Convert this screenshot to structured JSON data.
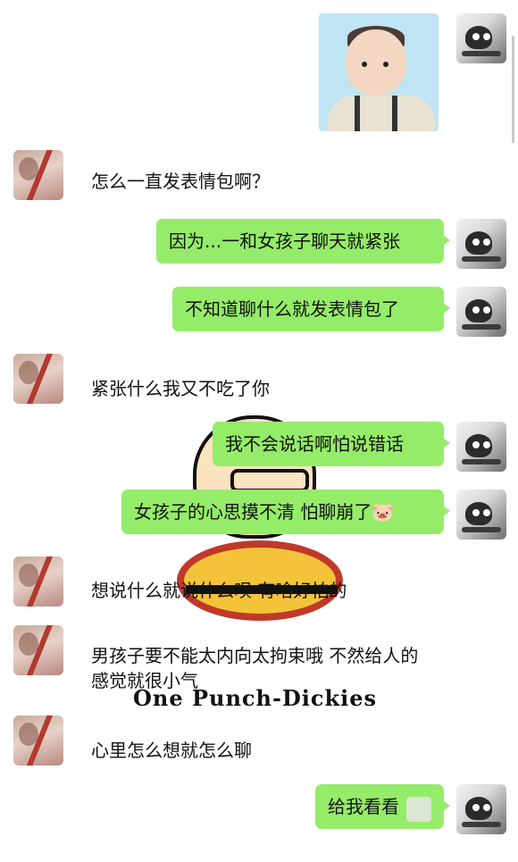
{
  "chat": {
    "messages": [
      {
        "side": "right",
        "type": "sticker",
        "sticker_icon": "baby-sticker"
      },
      {
        "side": "left",
        "type": "text",
        "text": "怎么一直发表情包啊？"
      },
      {
        "side": "right",
        "type": "text",
        "text": "因为...一和女孩子聊天就紧张"
      },
      {
        "side": "right",
        "type": "text",
        "text": "不知道聊什么就发表情包了"
      },
      {
        "side": "left",
        "type": "text",
        "text": "紧张什么我又不吃了你"
      },
      {
        "side": "right",
        "type": "text",
        "text": "我不会说话啊怕说错话"
      },
      {
        "side": "right",
        "type": "text",
        "text": "女孩子的心思摸不清 怕聊崩了",
        "emoji": "🐷"
      },
      {
        "side": "left",
        "type": "text",
        "text": "想说什么就说什么呗 有啥好怕的"
      },
      {
        "side": "left",
        "type": "text",
        "text": "男孩子要不能太内向太拘束哦 不然给人的感觉就很小气"
      },
      {
        "side": "left",
        "type": "text",
        "text": "心里怎么想就怎么聊"
      },
      {
        "side": "right",
        "type": "text",
        "text": "给我看看"
      }
    ]
  },
  "background": {
    "watermark_text": "One Punch-Dickies"
  },
  "colors": {
    "bubble_sent": "#95ec69",
    "page_background": "#ffffff",
    "text": "#111111"
  }
}
